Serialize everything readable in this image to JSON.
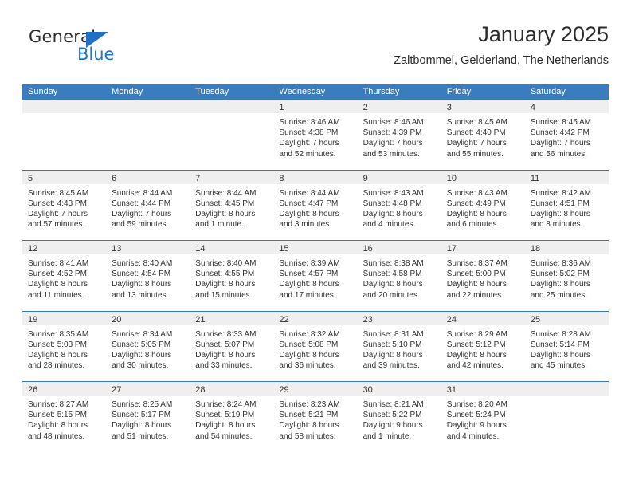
{
  "brand": {
    "name_part1": "General",
    "name_part2": "Blue",
    "triangle_color": "#1f6fc4",
    "blue_color": "#1f76d2"
  },
  "header": {
    "title": "January 2025",
    "subtitle": "Zaltbommel, Gelderland, The Netherlands"
  },
  "theme": {
    "header_bar_color": "#3a7cbe",
    "day_number_bar_color": "#efefef",
    "week_divider_color": "#3a7cbe",
    "text_color": "#333333"
  },
  "weekdays": [
    "Sunday",
    "Monday",
    "Tuesday",
    "Wednesday",
    "Thursday",
    "Friday",
    "Saturday"
  ],
  "weeks": [
    [
      {
        "empty": true
      },
      {
        "empty": true
      },
      {
        "empty": true
      },
      {
        "day": "1",
        "sunrise": "Sunrise: 8:46 AM",
        "sunset": "Sunset: 4:38 PM",
        "daylight1": "Daylight: 7 hours",
        "daylight2": "and 52 minutes."
      },
      {
        "day": "2",
        "sunrise": "Sunrise: 8:46 AM",
        "sunset": "Sunset: 4:39 PM",
        "daylight1": "Daylight: 7 hours",
        "daylight2": "and 53 minutes."
      },
      {
        "day": "3",
        "sunrise": "Sunrise: 8:45 AM",
        "sunset": "Sunset: 4:40 PM",
        "daylight1": "Daylight: 7 hours",
        "daylight2": "and 55 minutes."
      },
      {
        "day": "4",
        "sunrise": "Sunrise: 8:45 AM",
        "sunset": "Sunset: 4:42 PM",
        "daylight1": "Daylight: 7 hours",
        "daylight2": "and 56 minutes."
      }
    ],
    [
      {
        "day": "5",
        "sunrise": "Sunrise: 8:45 AM",
        "sunset": "Sunset: 4:43 PM",
        "daylight1": "Daylight: 7 hours",
        "daylight2": "and 57 minutes."
      },
      {
        "day": "6",
        "sunrise": "Sunrise: 8:44 AM",
        "sunset": "Sunset: 4:44 PM",
        "daylight1": "Daylight: 7 hours",
        "daylight2": "and 59 minutes."
      },
      {
        "day": "7",
        "sunrise": "Sunrise: 8:44 AM",
        "sunset": "Sunset: 4:45 PM",
        "daylight1": "Daylight: 8 hours",
        "daylight2": "and 1 minute."
      },
      {
        "day": "8",
        "sunrise": "Sunrise: 8:44 AM",
        "sunset": "Sunset: 4:47 PM",
        "daylight1": "Daylight: 8 hours",
        "daylight2": "and 3 minutes."
      },
      {
        "day": "9",
        "sunrise": "Sunrise: 8:43 AM",
        "sunset": "Sunset: 4:48 PM",
        "daylight1": "Daylight: 8 hours",
        "daylight2": "and 4 minutes."
      },
      {
        "day": "10",
        "sunrise": "Sunrise: 8:43 AM",
        "sunset": "Sunset: 4:49 PM",
        "daylight1": "Daylight: 8 hours",
        "daylight2": "and 6 minutes."
      },
      {
        "day": "11",
        "sunrise": "Sunrise: 8:42 AM",
        "sunset": "Sunset: 4:51 PM",
        "daylight1": "Daylight: 8 hours",
        "daylight2": "and 8 minutes."
      }
    ],
    [
      {
        "day": "12",
        "sunrise": "Sunrise: 8:41 AM",
        "sunset": "Sunset: 4:52 PM",
        "daylight1": "Daylight: 8 hours",
        "daylight2": "and 11 minutes."
      },
      {
        "day": "13",
        "sunrise": "Sunrise: 8:40 AM",
        "sunset": "Sunset: 4:54 PM",
        "daylight1": "Daylight: 8 hours",
        "daylight2": "and 13 minutes."
      },
      {
        "day": "14",
        "sunrise": "Sunrise: 8:40 AM",
        "sunset": "Sunset: 4:55 PM",
        "daylight1": "Daylight: 8 hours",
        "daylight2": "and 15 minutes."
      },
      {
        "day": "15",
        "sunrise": "Sunrise: 8:39 AM",
        "sunset": "Sunset: 4:57 PM",
        "daylight1": "Daylight: 8 hours",
        "daylight2": "and 17 minutes."
      },
      {
        "day": "16",
        "sunrise": "Sunrise: 8:38 AM",
        "sunset": "Sunset: 4:58 PM",
        "daylight1": "Daylight: 8 hours",
        "daylight2": "and 20 minutes."
      },
      {
        "day": "17",
        "sunrise": "Sunrise: 8:37 AM",
        "sunset": "Sunset: 5:00 PM",
        "daylight1": "Daylight: 8 hours",
        "daylight2": "and 22 minutes."
      },
      {
        "day": "18",
        "sunrise": "Sunrise: 8:36 AM",
        "sunset": "Sunset: 5:02 PM",
        "daylight1": "Daylight: 8 hours",
        "daylight2": "and 25 minutes."
      }
    ],
    [
      {
        "day": "19",
        "sunrise": "Sunrise: 8:35 AM",
        "sunset": "Sunset: 5:03 PM",
        "daylight1": "Daylight: 8 hours",
        "daylight2": "and 28 minutes."
      },
      {
        "day": "20",
        "sunrise": "Sunrise: 8:34 AM",
        "sunset": "Sunset: 5:05 PM",
        "daylight1": "Daylight: 8 hours",
        "daylight2": "and 30 minutes."
      },
      {
        "day": "21",
        "sunrise": "Sunrise: 8:33 AM",
        "sunset": "Sunset: 5:07 PM",
        "daylight1": "Daylight: 8 hours",
        "daylight2": "and 33 minutes."
      },
      {
        "day": "22",
        "sunrise": "Sunrise: 8:32 AM",
        "sunset": "Sunset: 5:08 PM",
        "daylight1": "Daylight: 8 hours",
        "daylight2": "and 36 minutes."
      },
      {
        "day": "23",
        "sunrise": "Sunrise: 8:31 AM",
        "sunset": "Sunset: 5:10 PM",
        "daylight1": "Daylight: 8 hours",
        "daylight2": "and 39 minutes."
      },
      {
        "day": "24",
        "sunrise": "Sunrise: 8:29 AM",
        "sunset": "Sunset: 5:12 PM",
        "daylight1": "Daylight: 8 hours",
        "daylight2": "and 42 minutes."
      },
      {
        "day": "25",
        "sunrise": "Sunrise: 8:28 AM",
        "sunset": "Sunset: 5:14 PM",
        "daylight1": "Daylight: 8 hours",
        "daylight2": "and 45 minutes."
      }
    ],
    [
      {
        "day": "26",
        "sunrise": "Sunrise: 8:27 AM",
        "sunset": "Sunset: 5:15 PM",
        "daylight1": "Daylight: 8 hours",
        "daylight2": "and 48 minutes."
      },
      {
        "day": "27",
        "sunrise": "Sunrise: 8:25 AM",
        "sunset": "Sunset: 5:17 PM",
        "daylight1": "Daylight: 8 hours",
        "daylight2": "and 51 minutes."
      },
      {
        "day": "28",
        "sunrise": "Sunrise: 8:24 AM",
        "sunset": "Sunset: 5:19 PM",
        "daylight1": "Daylight: 8 hours",
        "daylight2": "and 54 minutes."
      },
      {
        "day": "29",
        "sunrise": "Sunrise: 8:23 AM",
        "sunset": "Sunset: 5:21 PM",
        "daylight1": "Daylight: 8 hours",
        "daylight2": "and 58 minutes."
      },
      {
        "day": "30",
        "sunrise": "Sunrise: 8:21 AM",
        "sunset": "Sunset: 5:22 PM",
        "daylight1": "Daylight: 9 hours",
        "daylight2": "and 1 minute."
      },
      {
        "day": "31",
        "sunrise": "Sunrise: 8:20 AM",
        "sunset": "Sunset: 5:24 PM",
        "daylight1": "Daylight: 9 hours",
        "daylight2": "and 4 minutes."
      },
      {
        "empty": true
      }
    ]
  ]
}
